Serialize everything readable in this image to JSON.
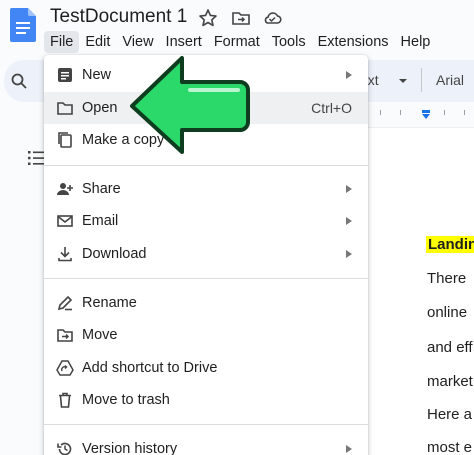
{
  "header": {
    "title": "TestDocument 1",
    "icons": [
      "star-icon",
      "move-to-folder-icon",
      "cloud-status-icon"
    ]
  },
  "menubar": {
    "items": [
      "File",
      "Edit",
      "View",
      "Insert",
      "Format",
      "Tools",
      "Extensions",
      "Help"
    ],
    "active": "File"
  },
  "toolbar": {
    "style_fragment": "ext",
    "font_fragment": "Arial"
  },
  "document": {
    "heading_fragment": "Landin",
    "lines": [
      "There",
      "online",
      "and eff",
      "market",
      "Here a",
      "most e"
    ]
  },
  "file_menu": {
    "items": [
      {
        "label": "New",
        "icon": "document-icon",
        "submenu": true
      },
      {
        "label": "Open",
        "icon": "folder-icon",
        "shortcut": "Ctrl+O",
        "highlighted": true
      },
      {
        "label": "Make a copy",
        "icon": "copy-icon"
      },
      {
        "label": "Share",
        "icon": "person-add-icon",
        "submenu": true
      },
      {
        "label": "Email",
        "icon": "email-icon",
        "submenu": true
      },
      {
        "label": "Download",
        "icon": "download-icon",
        "submenu": true
      },
      {
        "label": "Rename",
        "icon": "rename-icon"
      },
      {
        "label": "Move",
        "icon": "move-folder-icon"
      },
      {
        "label": "Add shortcut to Drive",
        "icon": "drive-shortcut-icon"
      },
      {
        "label": "Move to trash",
        "icon": "trash-icon"
      },
      {
        "label": "Version history",
        "icon": "history-icon",
        "submenu": true
      }
    ]
  },
  "colors": {
    "docs_blue": "#4285f4",
    "annotation_green": "#2bd96b",
    "highlight_yellow": "#ffff00",
    "menu_hover": "#eef0f2"
  }
}
